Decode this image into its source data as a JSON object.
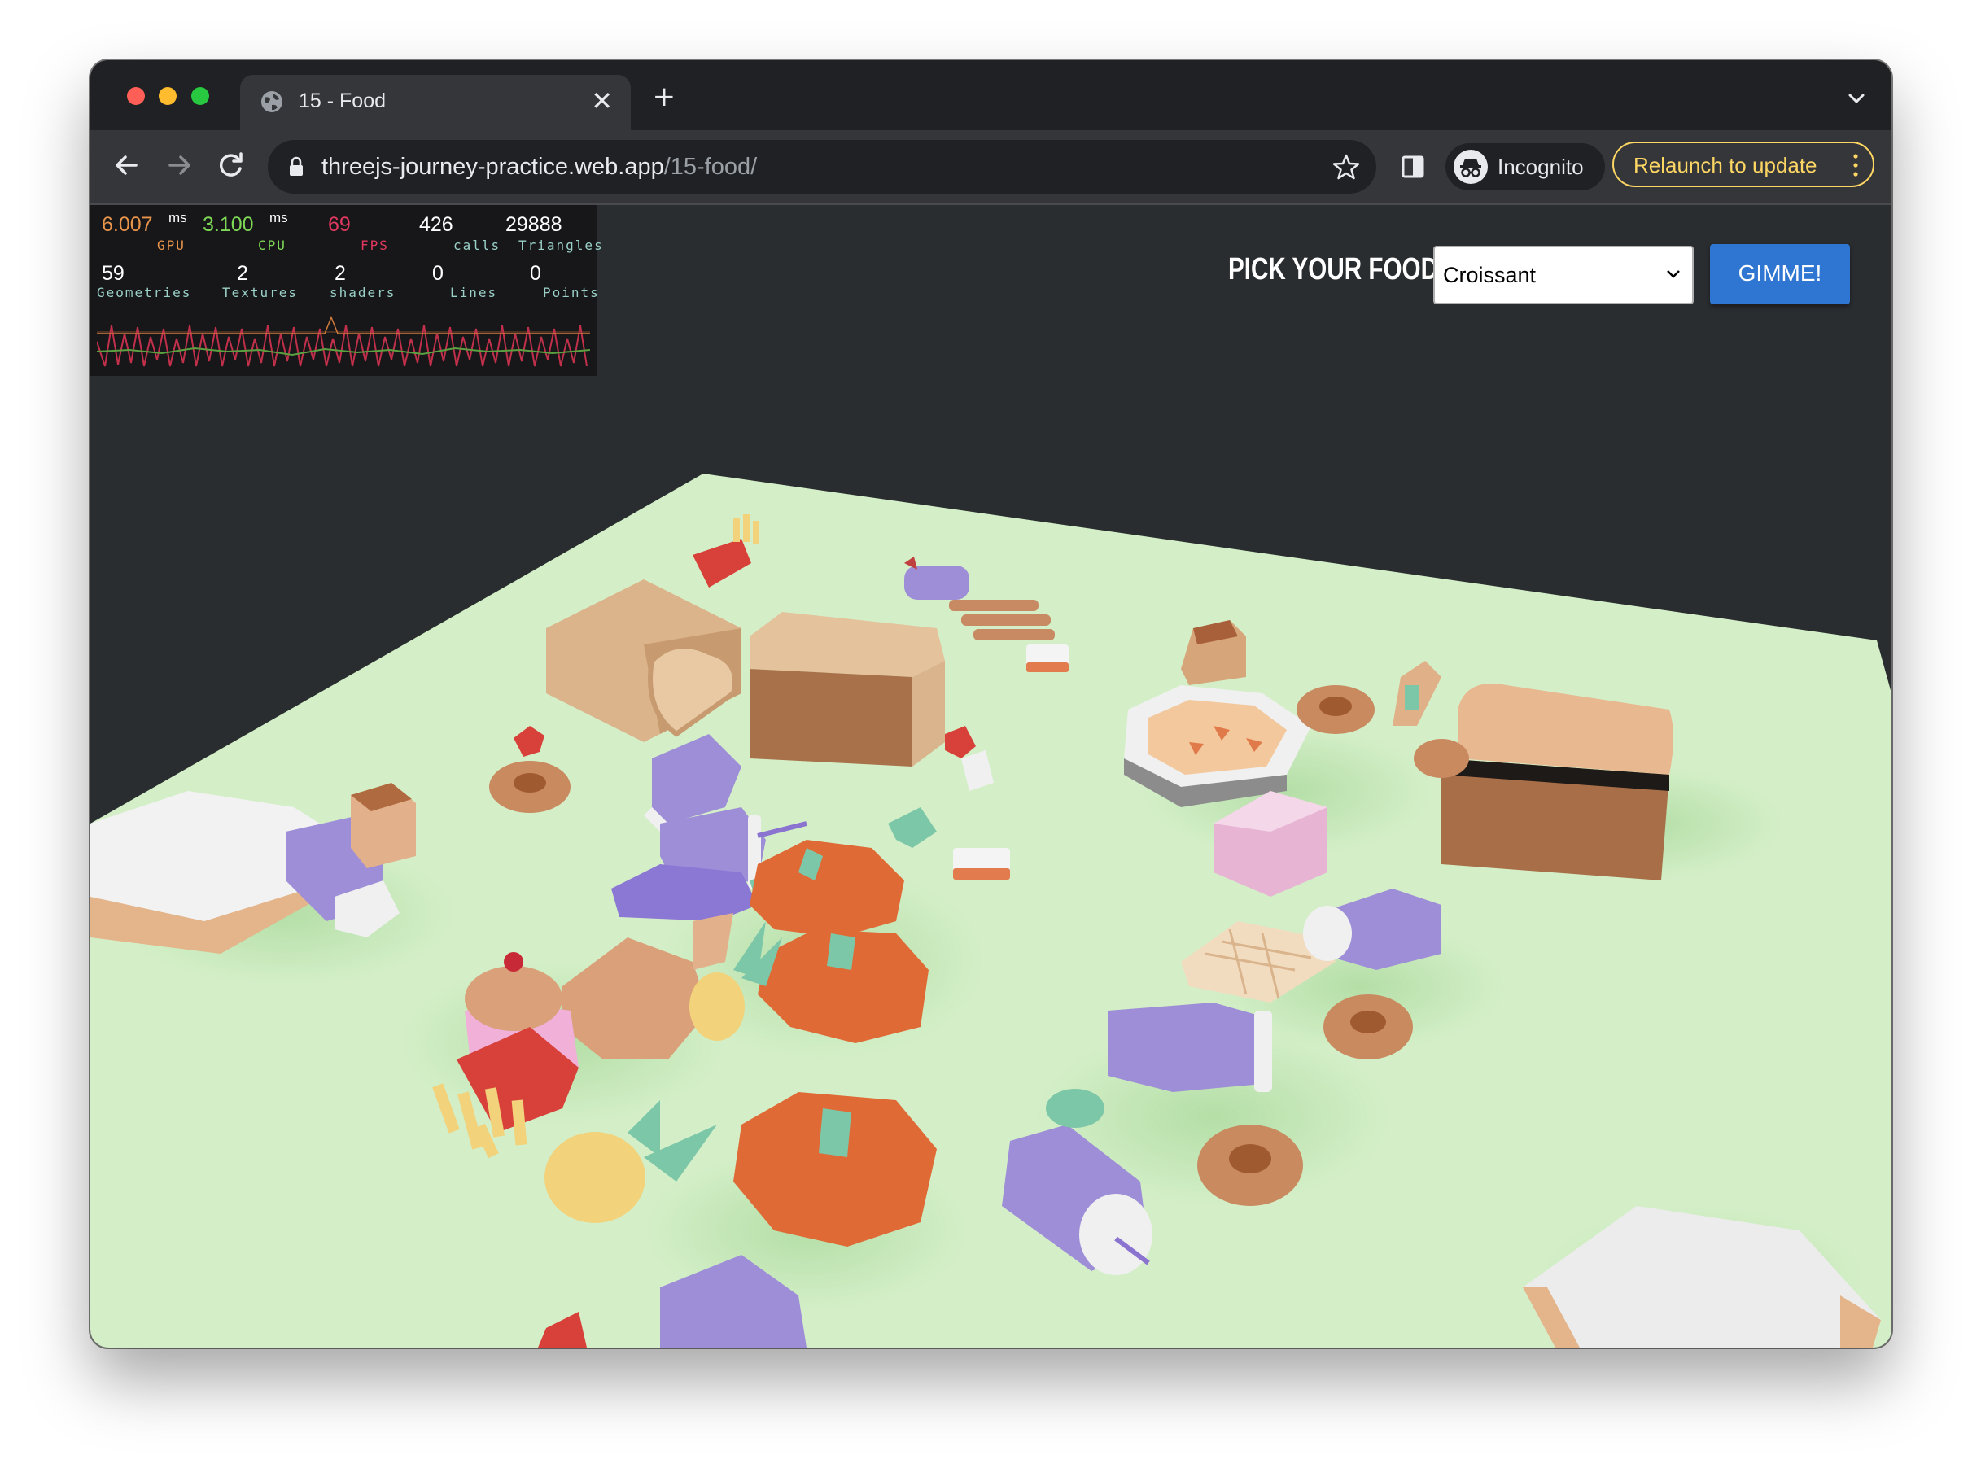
{
  "browser": {
    "tab_title": "15 - Food",
    "url_host": "threejs-journey-practice.web.app",
    "url_path": "/15-food/",
    "incognito_label": "Incognito",
    "relaunch_label": "Relaunch to update"
  },
  "stats": {
    "gpu_value": "6.007",
    "gpu_unit": "ms",
    "gpu_label": "GPU",
    "cpu_value": "3.100",
    "cpu_unit": "ms",
    "cpu_label": "CPU",
    "fps_value": "69",
    "fps_label": "FPS",
    "calls_value": "426",
    "calls_label": "calls",
    "triangles_value": "29888",
    "triangles_label": "Triangles",
    "geometries_value": "59",
    "geometries_label": "Geometries",
    "textures_value": "2",
    "textures_label": "Textures",
    "shaders_value": "2",
    "shaders_label": "shaders",
    "lines_value": "0",
    "lines_label": "Lines",
    "points_value": "0",
    "points_label": "Points",
    "colors": {
      "gpu": "#e8944a",
      "cpu": "#7ed957",
      "fps": "#e0385e",
      "neutral": "#ffffff",
      "label": "#9ad0c8"
    }
  },
  "food_picker": {
    "label": "PICK YOUR FOOD",
    "selected": "Croissant",
    "button_label": "GIMME!"
  },
  "colors": {
    "accent": "#2f76d2",
    "relaunch": "#fdd663",
    "ground": "#d4efc8",
    "canvas_bg": "#2a2d30"
  },
  "icons": [
    "globe-icon",
    "close-icon",
    "plus-icon",
    "chevron-down-icon",
    "back-arrow-icon",
    "forward-arrow-icon",
    "reload-icon",
    "lock-icon",
    "star-icon",
    "side-panel-icon",
    "incognito-icon",
    "more-vert-icon"
  ]
}
